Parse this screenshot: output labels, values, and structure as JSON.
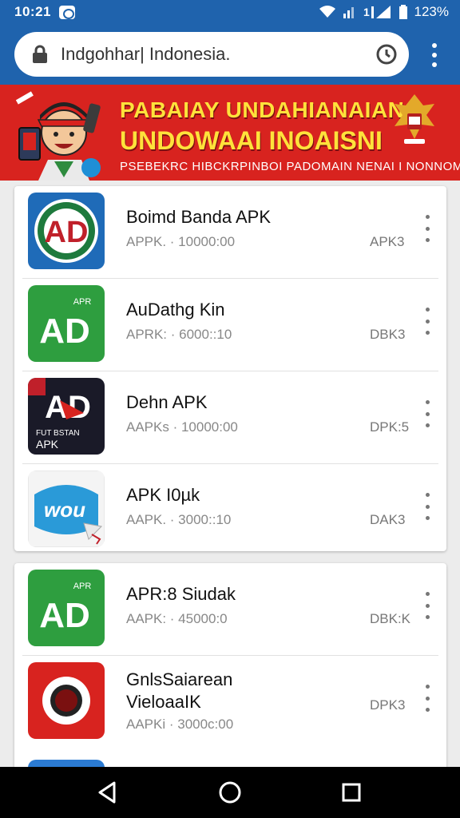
{
  "status_bar": {
    "time": "10:21",
    "battery_percent": "123%"
  },
  "url_bar": {
    "url": "Indgohhar| Indonesia."
  },
  "banner": {
    "line1": "PABAIAY UNDAHIANAIAN",
    "line2": "UNDOWAAI INOAISNI",
    "line3": "PSEBEKRC HIBCKRPINBOI PADOMAIN NENAI I NONNOM"
  },
  "apps": [
    {
      "name": "Boimd Banda APK",
      "meta": "APPK. · 10000:00",
      "badge": "APK3",
      "icon": "ad-circle-icon"
    },
    {
      "name": "AuDathg Kin",
      "meta": "APRK: · 6000::10",
      "badge": "DBK3",
      "icon": "ad-green-icon"
    },
    {
      "name": "Dehn APK",
      "meta": "AAPKs · 10000:00",
      "badge": "DPK:5",
      "icon": "ad-dark-icon"
    },
    {
      "name": "APK I0µk",
      "meta": "AAPK. · 3000::10",
      "badge": "DAK3",
      "icon": "wou-icon"
    },
    {
      "name": "APR:8 Siudak",
      "meta": "AAPK: · 45000:0",
      "badge": "DBK:K",
      "icon": "ad-green-icon"
    },
    {
      "name_line1": "GnlsSaiarean",
      "name_line2": "VieloaaIK",
      "meta": "AAPKi · 3000c:00",
      "badge": "DPK3",
      "icon": "red-eye-icon"
    }
  ],
  "app_icon_text": {
    "ad": "AD",
    "apr": "APR",
    "fut": "FUT BSTAN",
    "apk": "APK",
    "wou": "wou"
  }
}
